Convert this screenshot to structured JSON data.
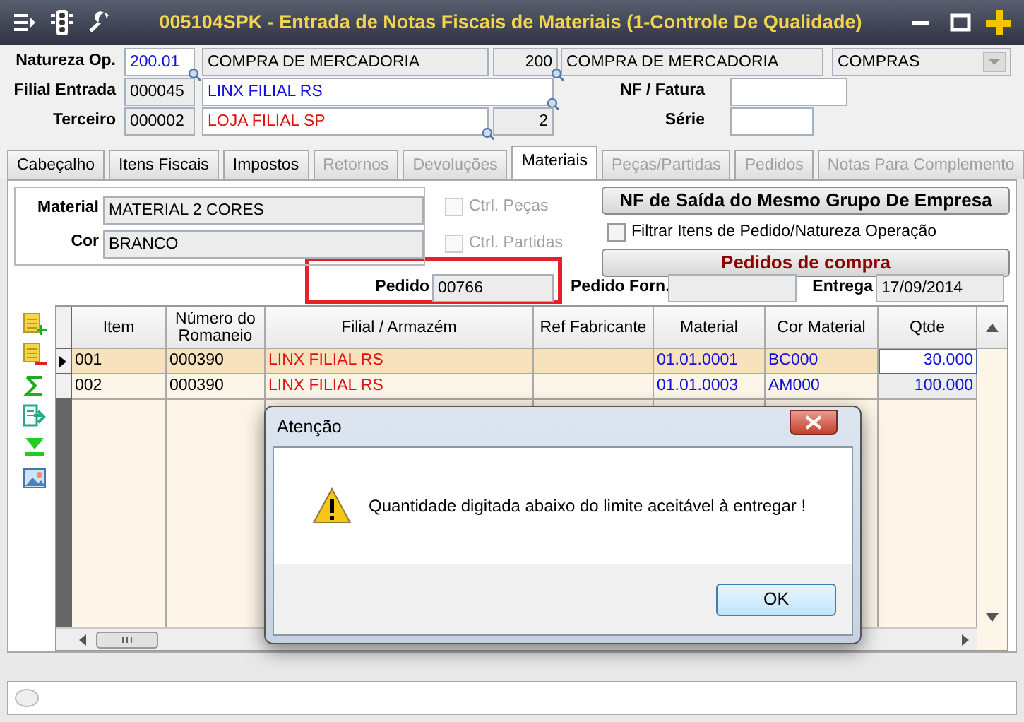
{
  "window": {
    "title": "005104SPK - Entrada de Notas Fiscais de Materiais (1-Controle De Qualidade)"
  },
  "header": {
    "rows": [
      {
        "items": [
          {
            "kind": "label",
            "text": "Natureza Op."
          },
          {
            "kind": "field",
            "value": "200.01",
            "readonly": false,
            "color": "#1010e0",
            "lookup": true
          },
          {
            "kind": "field",
            "value": "COMPRA DE MERCADORIA",
            "readonly": true,
            "lookup": false
          },
          {
            "kind": "field",
            "value": "200",
            "readonly": true,
            "lookup": true
          },
          {
            "kind": "field",
            "value": "COMPRA DE MERCADORIA",
            "readonly": true,
            "lookup": false
          },
          {
            "kind": "combo",
            "value": "COMPRAS"
          }
        ]
      },
      {
        "items": [
          {
            "kind": "label",
            "text": "Filial Entrada"
          },
          {
            "kind": "field",
            "value": "000045",
            "readonly": true,
            "lookup": false
          },
          {
            "kind": "field",
            "value": "LINX FILIAL RS",
            "readonly": false,
            "color": "#1010e0",
            "lookup": true
          },
          {
            "kind": "label",
            "text": "NF / Fatura"
          },
          {
            "kind": "field",
            "readonly": false,
            "lookup": false
          }
        ]
      },
      {
        "items": [
          {
            "kind": "label",
            "text": "Terceiro"
          },
          {
            "kind": "field",
            "value": "000002",
            "readonly": true,
            "lookup": false
          },
          {
            "kind": "field",
            "value": "LOJA FILIAL SP",
            "readonly": false,
            "color": "#e01010",
            "lookup": true
          },
          {
            "kind": "field",
            "value": "2",
            "readonly": true,
            "lookup": false
          },
          {
            "kind": "label",
            "text": "Série"
          },
          {
            "kind": "field",
            "readonly": false,
            "lookup": false
          }
        ]
      }
    ]
  },
  "tabs": [
    {
      "label": "Cabeçalho",
      "selected": false,
      "disabled": false
    },
    {
      "label": "Itens Fiscais",
      "selected": false,
      "disabled": false
    },
    {
      "label": "Impostos",
      "selected": false,
      "disabled": false
    },
    {
      "label": "Retornos",
      "selected": false,
      "disabled": true
    },
    {
      "label": "Devoluções",
      "selected": false,
      "disabled": true
    },
    {
      "label": "Materiais",
      "selected": true,
      "disabled": false
    },
    {
      "label": "Peças/Partidas",
      "selected": false,
      "disabled": true
    },
    {
      "label": "Pedidos",
      "selected": false,
      "disabled": true
    },
    {
      "label": "Notas Para Complemento",
      "selected": false,
      "disabled": true
    }
  ],
  "material": {
    "fields": [
      {
        "label": "Material",
        "value": "MATERIAL 2 CORES"
      },
      {
        "label": "Cor",
        "value": "BRANCO"
      }
    ],
    "checkboxes": [
      {
        "label": "Ctrl. Peças",
        "checked": false,
        "disabled": true
      },
      {
        "label": "Ctrl. Partidas",
        "checked": false,
        "disabled": true
      }
    ],
    "actions": [
      {
        "kind": "button",
        "label": "NF de Saída do Mesmo Grupo De Empresa"
      },
      {
        "kind": "checkbox",
        "label": "Filtrar Itens de Pedido/Natureza Operação",
        "checked": false
      },
      {
        "kind": "button",
        "label": "Pedidos de compra",
        "color": "#8b0000"
      }
    ]
  },
  "order_fields": [
    {
      "label": "Pedido",
      "value": "00766"
    },
    {
      "label": "Pedido Forn."
    },
    {
      "label": "Entrega",
      "value": "17/09/2014"
    }
  ],
  "grid": {
    "columns": [
      {
        "label": "Item"
      },
      {
        "label": "Número do Romaneio"
      },
      {
        "label": "Filial / Armazém",
        "color": "#e01010"
      },
      {
        "label": "Ref Fabricante"
      },
      {
        "label": "Material",
        "color": "#1010e0"
      },
      {
        "label": "Cor Material",
        "color": "#1010e0"
      },
      {
        "label": "Qtde",
        "color": "#1010e0"
      }
    ],
    "rows": [
      {
        "selected": true,
        "cells": [
          "001",
          "000390",
          "LINX FILIAL RS",
          "",
          "01.01.0001",
          "BC000",
          "30.000"
        ]
      },
      {
        "selected": false,
        "cells": [
          "002",
          "000390",
          "LINX FILIAL RS",
          "",
          "01.01.0003",
          "AM000",
          "100.000"
        ]
      }
    ]
  },
  "dialog": {
    "title": "Atenção",
    "message": "Quantidade digitada abaixo do limite aceitável à entregar !",
    "button": "OK"
  }
}
